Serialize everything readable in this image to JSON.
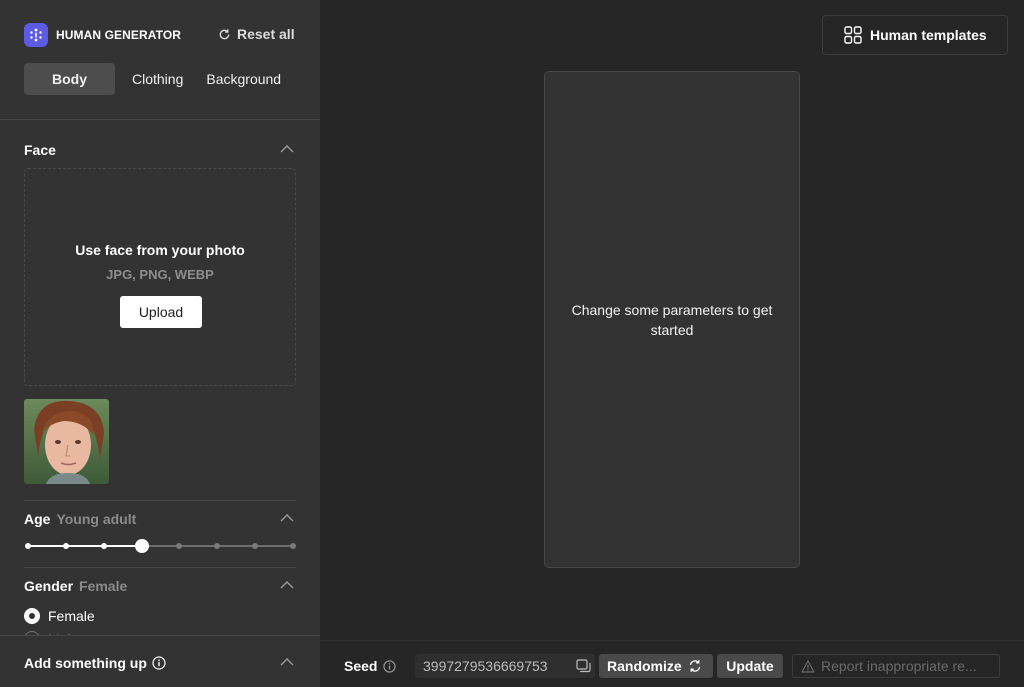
{
  "app": {
    "name": "HUMAN GENERATOR",
    "reset_label": "Reset all"
  },
  "tabs": [
    {
      "label": "Body",
      "active": true
    },
    {
      "label": "Clothing",
      "active": false
    },
    {
      "label": "Background",
      "active": false
    }
  ],
  "face": {
    "title": "Face",
    "dropzone_title": "Use face from your photo",
    "dropzone_formats": "JPG, PNG, WEBP",
    "upload_label": "Upload"
  },
  "age": {
    "title": "Age",
    "value": "Young adult",
    "steps": 8,
    "selected_index": 3
  },
  "gender": {
    "title": "Gender",
    "value": "Female",
    "options": [
      "Female",
      "Male"
    ],
    "selected": "Female"
  },
  "add_section": {
    "title": "Add something up"
  },
  "templates_label": "Human templates",
  "canvas_message": "Change some parameters to get started",
  "bottom": {
    "seed_label": "Seed",
    "seed_value": "3997279536669753",
    "randomize_label": "Randomize",
    "update_label": "Update",
    "report_label": "Report inappropriate re..."
  },
  "colors": {
    "accent": "#5b5be6",
    "sidebar_bg": "#333333",
    "main_bg": "#262626"
  }
}
